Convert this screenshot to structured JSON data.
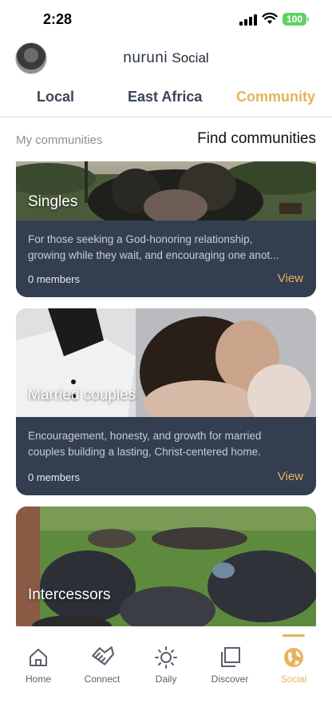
{
  "status_bar": {
    "time": "2:28",
    "battery": "100"
  },
  "header": {
    "brand_name": "nuruni",
    "brand_suffix": "Social"
  },
  "tabs": [
    {
      "label": "Local",
      "active": false
    },
    {
      "label": "East Africa",
      "active": false
    },
    {
      "label": "Community",
      "active": true
    }
  ],
  "subtabs": {
    "my": "My communities",
    "find": "Find communities"
  },
  "communities": [
    {
      "title": "Singles",
      "description_lines": [
        "For those seeking a God-honoring relationship,",
        "growing while they wait, and encouraging one anot..."
      ],
      "members": "0 members",
      "view": "View"
    },
    {
      "title": "Married couples",
      "description_lines": [
        "Encouragement, honesty, and growth for married",
        "couples building a lasting, Christ-centered home."
      ],
      "members": "0 members",
      "view": "View"
    },
    {
      "title": "Intercessors",
      "description_lines": [
        "",
        ""
      ],
      "members": "",
      "view": ""
    }
  ],
  "nav": [
    {
      "label": "Home",
      "icon": "home-icon"
    },
    {
      "label": "Connect",
      "icon": "handshake-icon"
    },
    {
      "label": "Daily",
      "icon": "sun-icon"
    },
    {
      "label": "Discover",
      "icon": "stacked-squares-icon"
    },
    {
      "label": "Social",
      "icon": "globe-icon",
      "active": true
    }
  ],
  "colors": {
    "accent": "#e5b35a",
    "card": "#333e51",
    "battery": "#5fd066"
  }
}
